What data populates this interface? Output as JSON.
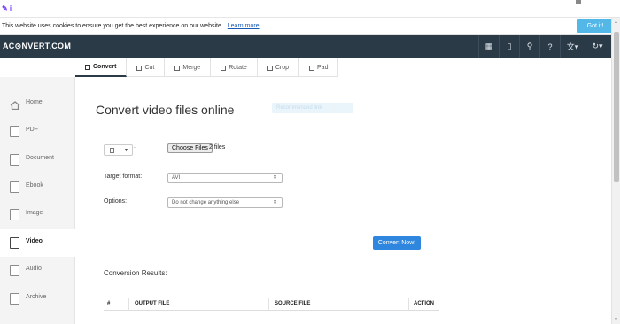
{
  "topstrip": {
    "tag": "✎ i"
  },
  "cookie": {
    "text": "This website uses cookies to ensure you get the best experience on our website.",
    "link": "Learn more",
    "button": "Got it!"
  },
  "header": {
    "logo": "AC⊙NVERT.COM",
    "icons": [
      "grid-icon",
      "mobile-icon",
      "search-icon",
      "help-icon",
      "language-icon",
      "refresh-icon"
    ]
  },
  "tabs": [
    {
      "label": "Convert"
    },
    {
      "label": "Cut"
    },
    {
      "label": "Merge"
    },
    {
      "label": "Rotate"
    },
    {
      "label": "Crop"
    },
    {
      "label": "Pad"
    }
  ],
  "sidebar": {
    "items": [
      {
        "label": "Home"
      },
      {
        "label": "PDF"
      },
      {
        "label": "Document"
      },
      {
        "label": "Ebook"
      },
      {
        "label": "Image"
      },
      {
        "label": "Video"
      },
      {
        "label": "Audio"
      },
      {
        "label": "Archive"
      }
    ],
    "active": "Video"
  },
  "main": {
    "title": "Convert video files online",
    "ghost_text": "Recommended link",
    "file_button": "Choose Files",
    "file_count": "2 files",
    "target_label": "Target format:",
    "target_value": "AVI",
    "options_label": "Options:",
    "options_value": "Do not change anything else",
    "convert_button": "Convert Now!",
    "results_label": "Conversion Results:",
    "table_headers": [
      "#",
      "OUTPUT FILE",
      "SOURCE FILE",
      "ACTION"
    ]
  }
}
